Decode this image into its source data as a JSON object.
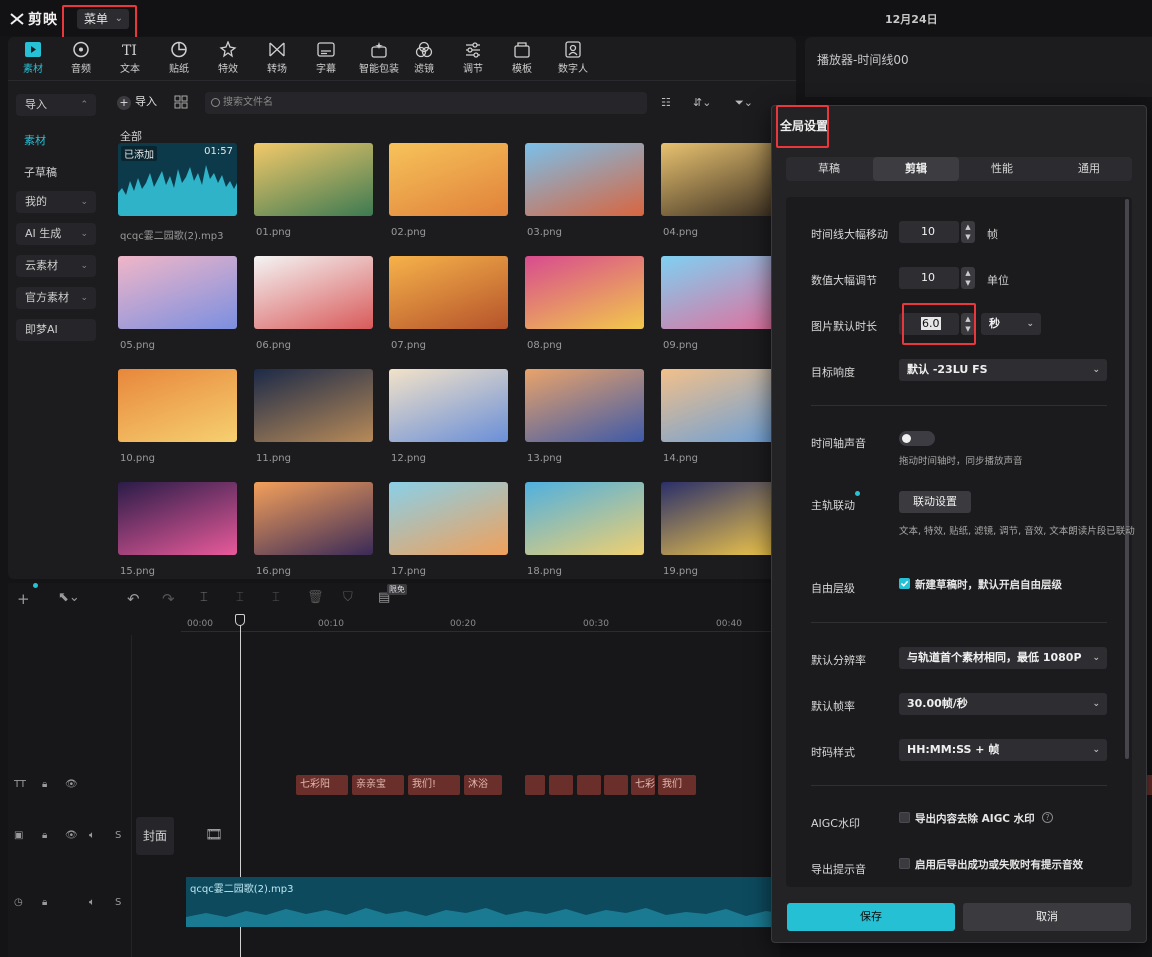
{
  "app": {
    "logo": "剪映",
    "menu_label": "菜单",
    "date": "12月24日"
  },
  "toolbar": {
    "items": [
      {
        "label": "素材",
        "icon": "media-icon",
        "active": true
      },
      {
        "label": "音频",
        "icon": "audio-icon"
      },
      {
        "label": "文本",
        "icon": "text-icon"
      },
      {
        "label": "贴纸",
        "icon": "sticker-icon"
      },
      {
        "label": "特效",
        "icon": "effects-icon"
      },
      {
        "label": "转场",
        "icon": "transition-icon"
      },
      {
        "label": "字幕",
        "icon": "subtitle-icon"
      },
      {
        "label": "智能包装",
        "icon": "smart-pack-icon"
      },
      {
        "label": "滤镜",
        "icon": "filter-icon"
      },
      {
        "label": "调节",
        "icon": "adjust-icon"
      },
      {
        "label": "模板",
        "icon": "template-icon"
      },
      {
        "label": "数字人",
        "icon": "digital-human-icon"
      }
    ]
  },
  "sidebar": {
    "items": [
      {
        "label": "导入",
        "expandable": true
      },
      {
        "label": "素材",
        "active": true
      },
      {
        "label": "子草稿"
      },
      {
        "label": "我的",
        "expandable": true
      },
      {
        "label": "AI 生成",
        "expandable": true
      },
      {
        "label": "云素材",
        "expandable": true
      },
      {
        "label": "官方素材",
        "expandable": true
      },
      {
        "label": "即梦AI"
      }
    ]
  },
  "media": {
    "import_label": "导入",
    "search_placeholder": "搜索文件名",
    "section_label": "全部",
    "audio": {
      "name": "qcqc霎二园歌(2).mp3",
      "added_tag": "已添加",
      "duration": "01:57"
    },
    "files": [
      "01.png",
      "02.png",
      "03.png",
      "04.png",
      "05.png",
      "06.png",
      "07.png",
      "08.png",
      "09.png",
      "10.png",
      "11.png",
      "12.png",
      "13.png",
      "14.png",
      "15.png",
      "16.png",
      "17.png",
      "18.png",
      "19.png"
    ]
  },
  "player": {
    "title": "播放器-时间线00"
  },
  "timeline": {
    "badge": "限免",
    "ruler": [
      "00:00",
      "00:10",
      "00:20",
      "00:30",
      "00:40"
    ],
    "cover_label": "封面",
    "audio_clip_label": "qcqc霎二园歌(2).mp3",
    "text_clips": [
      "七彩阳",
      "亲亲宝",
      "我们!",
      "沐浴",
      "",
      "",
      "",
      "",
      "七彩天",
      "我们"
    ],
    "track_tags": {
      "tt": "TT",
      "s": "S"
    }
  },
  "dialog": {
    "title": "全局设置",
    "tabs": [
      "草稿",
      "剪辑",
      "性能",
      "通用"
    ],
    "active_tab": "剪辑",
    "rows": {
      "timeline_step": {
        "label": "时间线大幅移动",
        "value": "10",
        "unit": "帧"
      },
      "value_step": {
        "label": "数值大幅调节",
        "value": "10",
        "unit": "单位"
      },
      "image_duration": {
        "label": "图片默认时长",
        "value": "6.0",
        "unit": "秒"
      },
      "target_loudness": {
        "label": "目标响度",
        "value": "默认 -23LU FS"
      },
      "timeline_audio": {
        "label": "时间轴声音",
        "hint": "拖动时间轴时，同步播放声音",
        "enabled": false
      },
      "main_track": {
        "label": "主轨联动",
        "button": "联动设置",
        "hint": "文本, 特效, 贴纸, 滤镜, 调节, 音效, 文本朗读片段已联动"
      },
      "free_layer": {
        "label": "自由层级",
        "checkbox": "新建草稿时，默认开启自由层级",
        "checked": true
      },
      "resolution": {
        "label": "默认分辨率",
        "value": "与轨道首个素材相同，最低 1080P"
      },
      "frame_rate": {
        "label": "默认帧率",
        "value": "30.00帧/秒"
      },
      "timecode": {
        "label": "时码样式",
        "value": "HH:MM:SS + 帧"
      },
      "aigc": {
        "label": "AIGC水印",
        "checkbox": "导出内容去除 AIGC 水印",
        "checked": false
      },
      "export_sound": {
        "label": "导出提示音",
        "checkbox": "启用后导出成功或失败时有提示音效",
        "checked": false
      }
    },
    "save_label": "保存",
    "cancel_label": "取消"
  },
  "colors": {
    "accent": "#27c1d6",
    "highlight": "#e8383d",
    "clip": "#6a2f2a",
    "audio": "#0d4a5e"
  }
}
